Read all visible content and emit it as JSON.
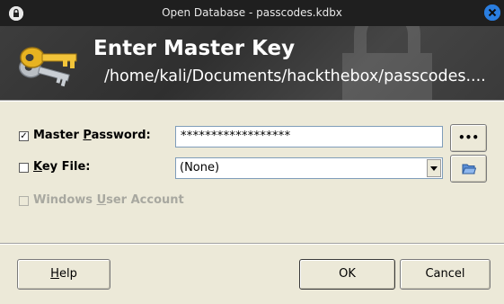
{
  "window": {
    "title": "Open Database - passcodes.kdbx",
    "icon": "lock-icon",
    "close_icon": "close-icon"
  },
  "banner": {
    "title": "Enter Master Key",
    "path": "/home/kali/Documents/hackthebox/passcodes...."
  },
  "master_password": {
    "label_pre": "Master ",
    "label_u": "P",
    "label_post": "assword:",
    "checked": true,
    "value": "******************",
    "reveal_label": "•••"
  },
  "key_file": {
    "label_u": "K",
    "label_post": "ey File:",
    "checked": false,
    "selected": "(None)",
    "browse_icon": "folder-open-icon"
  },
  "windows_account": {
    "label_pre": "Windows ",
    "label_u": "U",
    "label_post": "ser Account",
    "checked": false,
    "enabled": false
  },
  "buttons": {
    "help_u": "H",
    "help_post": "elp",
    "ok": "OK",
    "cancel": "Cancel"
  },
  "colors": {
    "titlebar": "#1f1f1f",
    "banner": "#3d3d3d",
    "dialog_bg": "#ece9d8",
    "close_accent": "#2a7ee0"
  }
}
